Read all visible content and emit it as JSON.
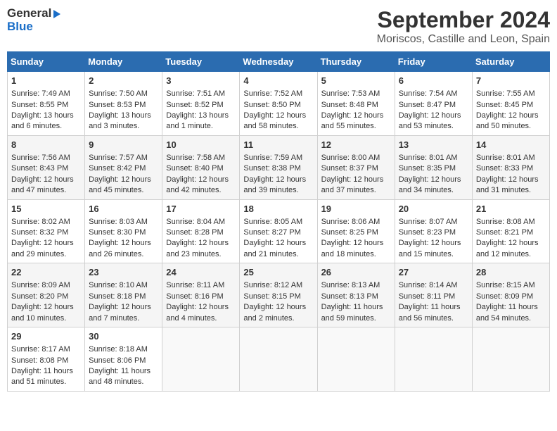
{
  "header": {
    "logo_line1": "General",
    "logo_line2": "Blue",
    "month": "September 2024",
    "location": "Moriscos, Castille and Leon, Spain"
  },
  "days_of_week": [
    "Sunday",
    "Monday",
    "Tuesday",
    "Wednesday",
    "Thursday",
    "Friday",
    "Saturday"
  ],
  "weeks": [
    [
      {
        "day": 1,
        "info": "Sunrise: 7:49 AM\nSunset: 8:55 PM\nDaylight: 13 hours and 6 minutes."
      },
      {
        "day": 2,
        "info": "Sunrise: 7:50 AM\nSunset: 8:53 PM\nDaylight: 13 hours and 3 minutes."
      },
      {
        "day": 3,
        "info": "Sunrise: 7:51 AM\nSunset: 8:52 PM\nDaylight: 13 hours and 1 minute."
      },
      {
        "day": 4,
        "info": "Sunrise: 7:52 AM\nSunset: 8:50 PM\nDaylight: 12 hours and 58 minutes."
      },
      {
        "day": 5,
        "info": "Sunrise: 7:53 AM\nSunset: 8:48 PM\nDaylight: 12 hours and 55 minutes."
      },
      {
        "day": 6,
        "info": "Sunrise: 7:54 AM\nSunset: 8:47 PM\nDaylight: 12 hours and 53 minutes."
      },
      {
        "day": 7,
        "info": "Sunrise: 7:55 AM\nSunset: 8:45 PM\nDaylight: 12 hours and 50 minutes."
      }
    ],
    [
      {
        "day": 8,
        "info": "Sunrise: 7:56 AM\nSunset: 8:43 PM\nDaylight: 12 hours and 47 minutes."
      },
      {
        "day": 9,
        "info": "Sunrise: 7:57 AM\nSunset: 8:42 PM\nDaylight: 12 hours and 45 minutes."
      },
      {
        "day": 10,
        "info": "Sunrise: 7:58 AM\nSunset: 8:40 PM\nDaylight: 12 hours and 42 minutes."
      },
      {
        "day": 11,
        "info": "Sunrise: 7:59 AM\nSunset: 8:38 PM\nDaylight: 12 hours and 39 minutes."
      },
      {
        "day": 12,
        "info": "Sunrise: 8:00 AM\nSunset: 8:37 PM\nDaylight: 12 hours and 37 minutes."
      },
      {
        "day": 13,
        "info": "Sunrise: 8:01 AM\nSunset: 8:35 PM\nDaylight: 12 hours and 34 minutes."
      },
      {
        "day": 14,
        "info": "Sunrise: 8:01 AM\nSunset: 8:33 PM\nDaylight: 12 hours and 31 minutes."
      }
    ],
    [
      {
        "day": 15,
        "info": "Sunrise: 8:02 AM\nSunset: 8:32 PM\nDaylight: 12 hours and 29 minutes."
      },
      {
        "day": 16,
        "info": "Sunrise: 8:03 AM\nSunset: 8:30 PM\nDaylight: 12 hours and 26 minutes."
      },
      {
        "day": 17,
        "info": "Sunrise: 8:04 AM\nSunset: 8:28 PM\nDaylight: 12 hours and 23 minutes."
      },
      {
        "day": 18,
        "info": "Sunrise: 8:05 AM\nSunset: 8:27 PM\nDaylight: 12 hours and 21 minutes."
      },
      {
        "day": 19,
        "info": "Sunrise: 8:06 AM\nSunset: 8:25 PM\nDaylight: 12 hours and 18 minutes."
      },
      {
        "day": 20,
        "info": "Sunrise: 8:07 AM\nSunset: 8:23 PM\nDaylight: 12 hours and 15 minutes."
      },
      {
        "day": 21,
        "info": "Sunrise: 8:08 AM\nSunset: 8:21 PM\nDaylight: 12 hours and 12 minutes."
      }
    ],
    [
      {
        "day": 22,
        "info": "Sunrise: 8:09 AM\nSunset: 8:20 PM\nDaylight: 12 hours and 10 minutes."
      },
      {
        "day": 23,
        "info": "Sunrise: 8:10 AM\nSunset: 8:18 PM\nDaylight: 12 hours and 7 minutes."
      },
      {
        "day": 24,
        "info": "Sunrise: 8:11 AM\nSunset: 8:16 PM\nDaylight: 12 hours and 4 minutes."
      },
      {
        "day": 25,
        "info": "Sunrise: 8:12 AM\nSunset: 8:15 PM\nDaylight: 12 hours and 2 minutes."
      },
      {
        "day": 26,
        "info": "Sunrise: 8:13 AM\nSunset: 8:13 PM\nDaylight: 11 hours and 59 minutes."
      },
      {
        "day": 27,
        "info": "Sunrise: 8:14 AM\nSunset: 8:11 PM\nDaylight: 11 hours and 56 minutes."
      },
      {
        "day": 28,
        "info": "Sunrise: 8:15 AM\nSunset: 8:09 PM\nDaylight: 11 hours and 54 minutes."
      }
    ],
    [
      {
        "day": 29,
        "info": "Sunrise: 8:17 AM\nSunset: 8:08 PM\nDaylight: 11 hours and 51 minutes."
      },
      {
        "day": 30,
        "info": "Sunrise: 8:18 AM\nSunset: 8:06 PM\nDaylight: 11 hours and 48 minutes."
      },
      {
        "day": null,
        "info": ""
      },
      {
        "day": null,
        "info": ""
      },
      {
        "day": null,
        "info": ""
      },
      {
        "day": null,
        "info": ""
      },
      {
        "day": null,
        "info": ""
      }
    ]
  ]
}
